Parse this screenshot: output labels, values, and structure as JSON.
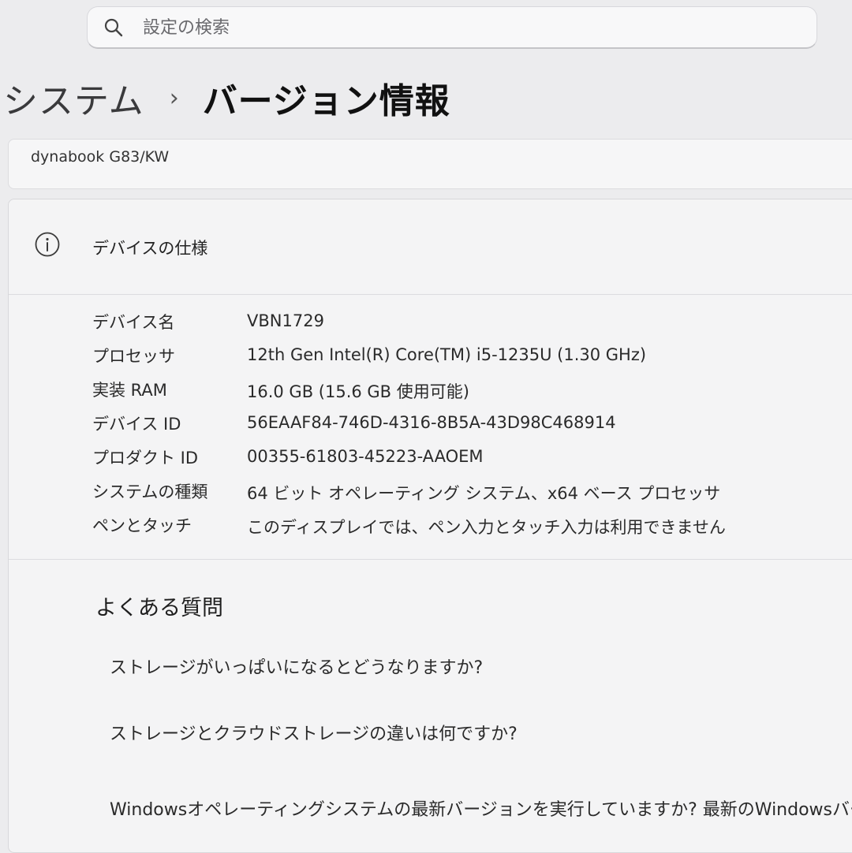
{
  "search": {
    "placeholder": "設定の検索"
  },
  "breadcrumb": {
    "parent": "システム",
    "separator": "›",
    "current": "バージョン情報"
  },
  "device": {
    "model": "dynabook G83/KW"
  },
  "specs": {
    "title": "デバイスの仕様",
    "rows": [
      {
        "label": "デバイス名",
        "value": "VBN1729"
      },
      {
        "label": "プロセッサ",
        "value": "12th Gen Intel(R) Core(TM) i5-1235U (1.30 GHz)"
      },
      {
        "label": "実装 RAM",
        "value": "16.0 GB (15.6 GB 使用可能)"
      },
      {
        "label": "デバイス ID",
        "value": "56EAAF84-746D-4316-8B5A-43D98C468914"
      },
      {
        "label": "プロダクト ID",
        "value": "00355-61803-45223-AAOEM"
      },
      {
        "label": "システムの種類",
        "value": "64 ビット オペレーティング システム、x64 ベース プロセッサ"
      },
      {
        "label": "ペンとタッチ",
        "value": "このディスプレイでは、ペン入力とタッチ入力は利用できません"
      }
    ]
  },
  "faq": {
    "title": "よくある質問",
    "items": [
      "ストレージがいっぱいになるとどうなりますか?",
      "ストレージとクラウドストレージの違いは何ですか?",
      "Windowsオペレーティングシステムの最新バージョンを実行していますか? 最新のWindowsバー"
    ]
  },
  "icons": {
    "search": "search-icon",
    "info": "info-icon"
  }
}
